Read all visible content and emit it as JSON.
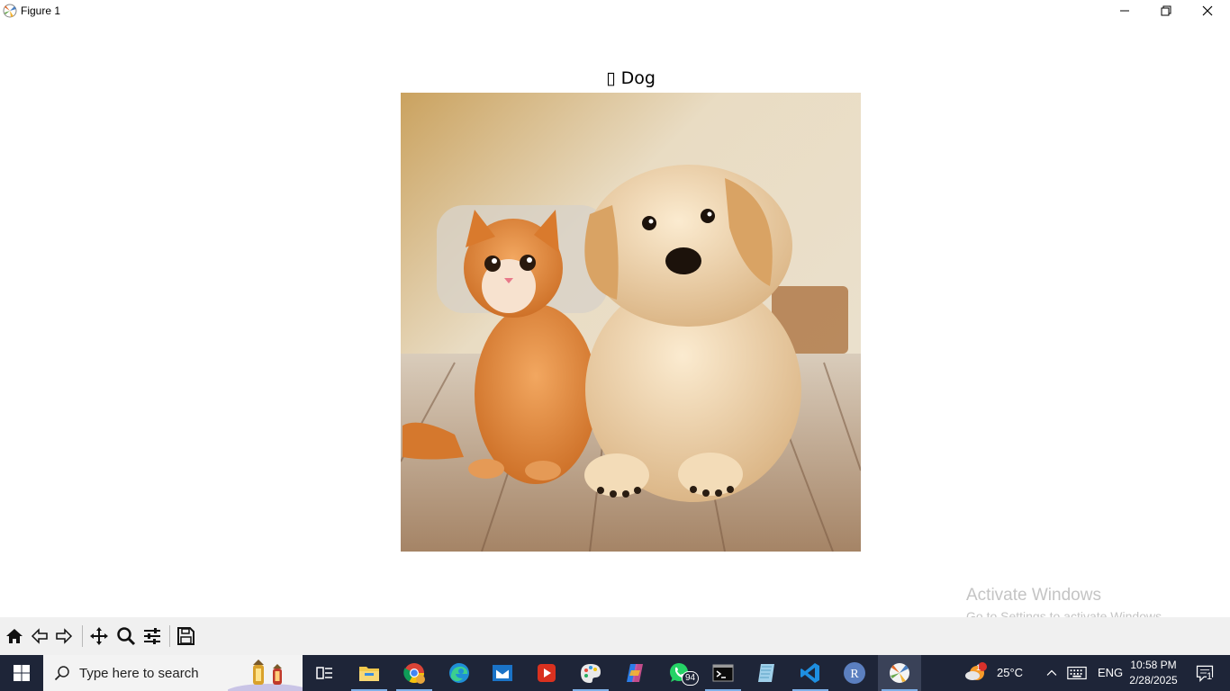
{
  "window": {
    "title": "Figure 1"
  },
  "figure": {
    "title": "▯ Dog",
    "image_alt": "cat and dog"
  },
  "watermark": {
    "title": "Activate Windows",
    "subtitle": "Go to Settings to activate Windows."
  },
  "toolbar": {
    "tools": [
      "home-icon",
      "back-icon",
      "forward-icon",
      "pan-icon",
      "zoom-icon",
      "configure-subplots-icon",
      "save-icon"
    ]
  },
  "taskbar": {
    "search_placeholder": "Type here to search",
    "whatsapp_badge": "94",
    "weather_badge": "1",
    "temperature": "25°C",
    "language": "ENG",
    "time": "10:58 PM",
    "date": "2/28/2025",
    "notification_count": "1",
    "r_label": "R"
  },
  "colors": {
    "taskbar": "#1e2538",
    "toolbar": "#f0f0f0",
    "accent": "#7fb0e8"
  }
}
